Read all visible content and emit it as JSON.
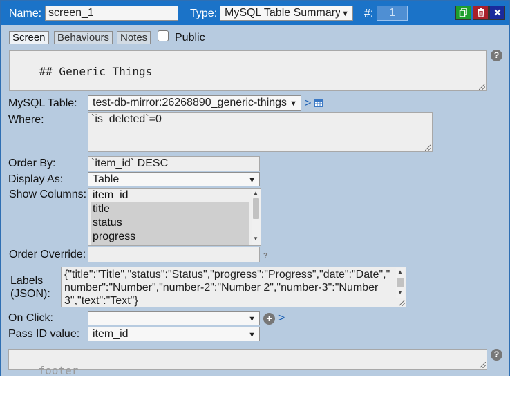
{
  "header": {
    "name_label": "Name:",
    "name_value": "screen_1",
    "type_label": "Type:",
    "type_value": "MySQL Table Summary",
    "num_label": "#:",
    "num_value": "1",
    "colors": {
      "bar": "#1b73c8",
      "copy": "#1e9e2c",
      "delete": "#a8202a",
      "close": "#1a2a9c"
    }
  },
  "tabs": [
    {
      "label": "Screen"
    },
    {
      "label": "Behaviours"
    },
    {
      "label": "Notes"
    }
  ],
  "public_label": "Public",
  "public_checked": false,
  "header_text": "## Generic Things",
  "help_glyph": "?",
  "mysql_table": {
    "label": "MySQL Table:",
    "value": "test-db-mirror:26268890_generic-things",
    "link": ">"
  },
  "where": {
    "label": "Where:",
    "value": "`is_deleted`=0"
  },
  "order_by": {
    "label": "Order By:",
    "value": "`item_id` DESC"
  },
  "display_as": {
    "label": "Display As:",
    "value": "Table"
  },
  "show_columns": {
    "label": "Show Columns:",
    "options": [
      {
        "label": "item_id",
        "selected": false
      },
      {
        "label": "title",
        "selected": true
      },
      {
        "label": "status",
        "selected": true
      },
      {
        "label": "progress",
        "selected": true
      }
    ]
  },
  "order_override": {
    "label": "Order Override:",
    "value": ""
  },
  "labels_json": {
    "label_line1": "Labels",
    "label_line2": "(JSON):",
    "line1": "{\"title\":\"Title\",\"status\":\"Status\",\"progress\":\"Progress\",\"date\":\"Date\",\"",
    "line2": "number\":\"Number\",\"number-2\":\"Number 2\",\"number-3\":\"Number",
    "line3": "3\",\"text\":\"Text\"}"
  },
  "on_click": {
    "label": "On Click:",
    "value": "",
    "link": ">"
  },
  "pass_id": {
    "label": "Pass ID value:",
    "value": "item_id"
  },
  "footer": {
    "placeholder": "footer"
  }
}
